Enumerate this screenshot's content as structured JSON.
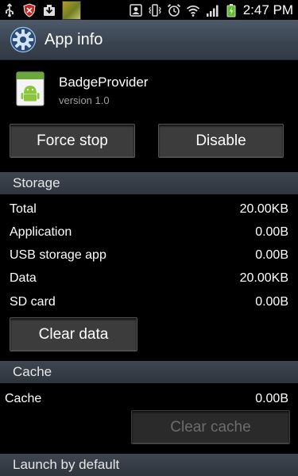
{
  "status_bar": {
    "icons": [
      "usb-icon",
      "shield-icon",
      "download-icon",
      "photo-thumbnail-icon",
      "contacts-icon",
      "vibrate-icon",
      "alarm-icon",
      "wifi-icon",
      "signal-icon",
      "battery-icon"
    ],
    "time": "2:47 PM"
  },
  "header": {
    "title": "App info",
    "icon": "gear-icon"
  },
  "app": {
    "name": "BadgeProvider",
    "version": "version 1.0",
    "icon": "android-app-icon"
  },
  "actions": {
    "force_stop": "Force stop",
    "disable": "Disable"
  },
  "storage": {
    "header": "Storage",
    "rows": [
      {
        "label": "Total",
        "value": "20.00KB"
      },
      {
        "label": "Application",
        "value": "0.00B"
      },
      {
        "label": "USB storage app",
        "value": "0.00B"
      },
      {
        "label": "Data",
        "value": "20.00KB"
      },
      {
        "label": "SD card",
        "value": "0.00B"
      }
    ],
    "clear_data": "Clear data"
  },
  "cache": {
    "header": "Cache",
    "label": "Cache",
    "value": "0.00B",
    "clear_cache": "Clear cache"
  },
  "launch": {
    "header": "Launch by default"
  }
}
